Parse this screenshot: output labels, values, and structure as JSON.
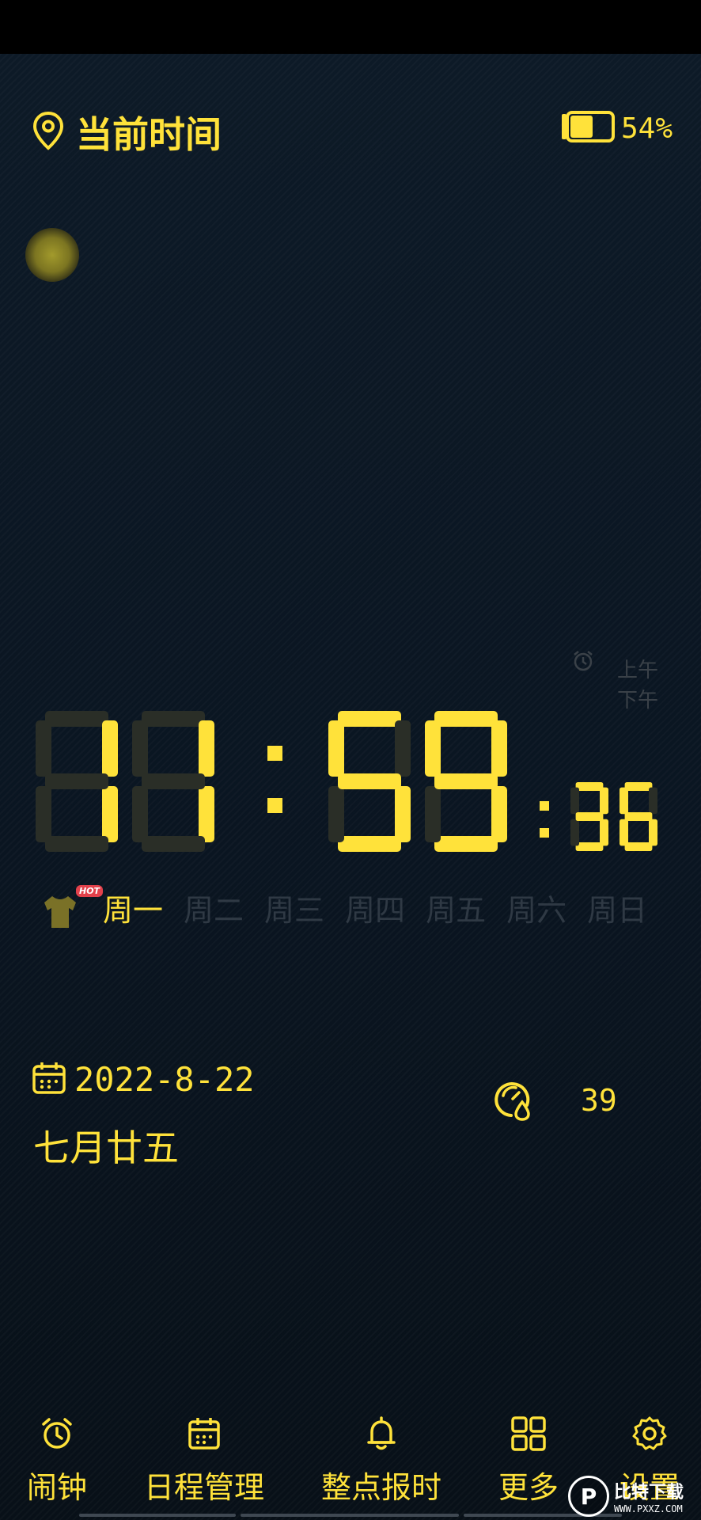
{
  "header": {
    "location_label": "当前时间",
    "battery_percent": "54%",
    "battery_level": 0.54
  },
  "clock": {
    "hours": "11",
    "minutes": "59",
    "seconds": "36",
    "am_label": "上午",
    "pm_label": "下午",
    "active_color": "#ffe23a",
    "ghost_color": "#2a2e27"
  },
  "weekdays": {
    "hot_badge": "HOT",
    "days": [
      "周一",
      "周二",
      "周三",
      "周四",
      "周五",
      "周六",
      "周日"
    ],
    "active_index": 0
  },
  "info": {
    "date": "2022-8-22",
    "lunar_date": "七月廿五",
    "humidity": "39"
  },
  "nav": {
    "items": [
      {
        "label": "闹钟",
        "icon": "alarm-clock-icon"
      },
      {
        "label": "日程管理",
        "icon": "calendar-icon"
      },
      {
        "label": "整点报时",
        "icon": "bell-icon"
      },
      {
        "label": "更多",
        "icon": "grid-icon"
      },
      {
        "label": "设置",
        "icon": "gear-icon"
      }
    ]
  },
  "watermark": {
    "logo_letter": "P",
    "title": "比特下载",
    "url": "WWW.PXXZ.COM"
  },
  "colors": {
    "accent": "#ffe23a",
    "background": "#0b1520",
    "inactive_text": "#2f3944"
  }
}
